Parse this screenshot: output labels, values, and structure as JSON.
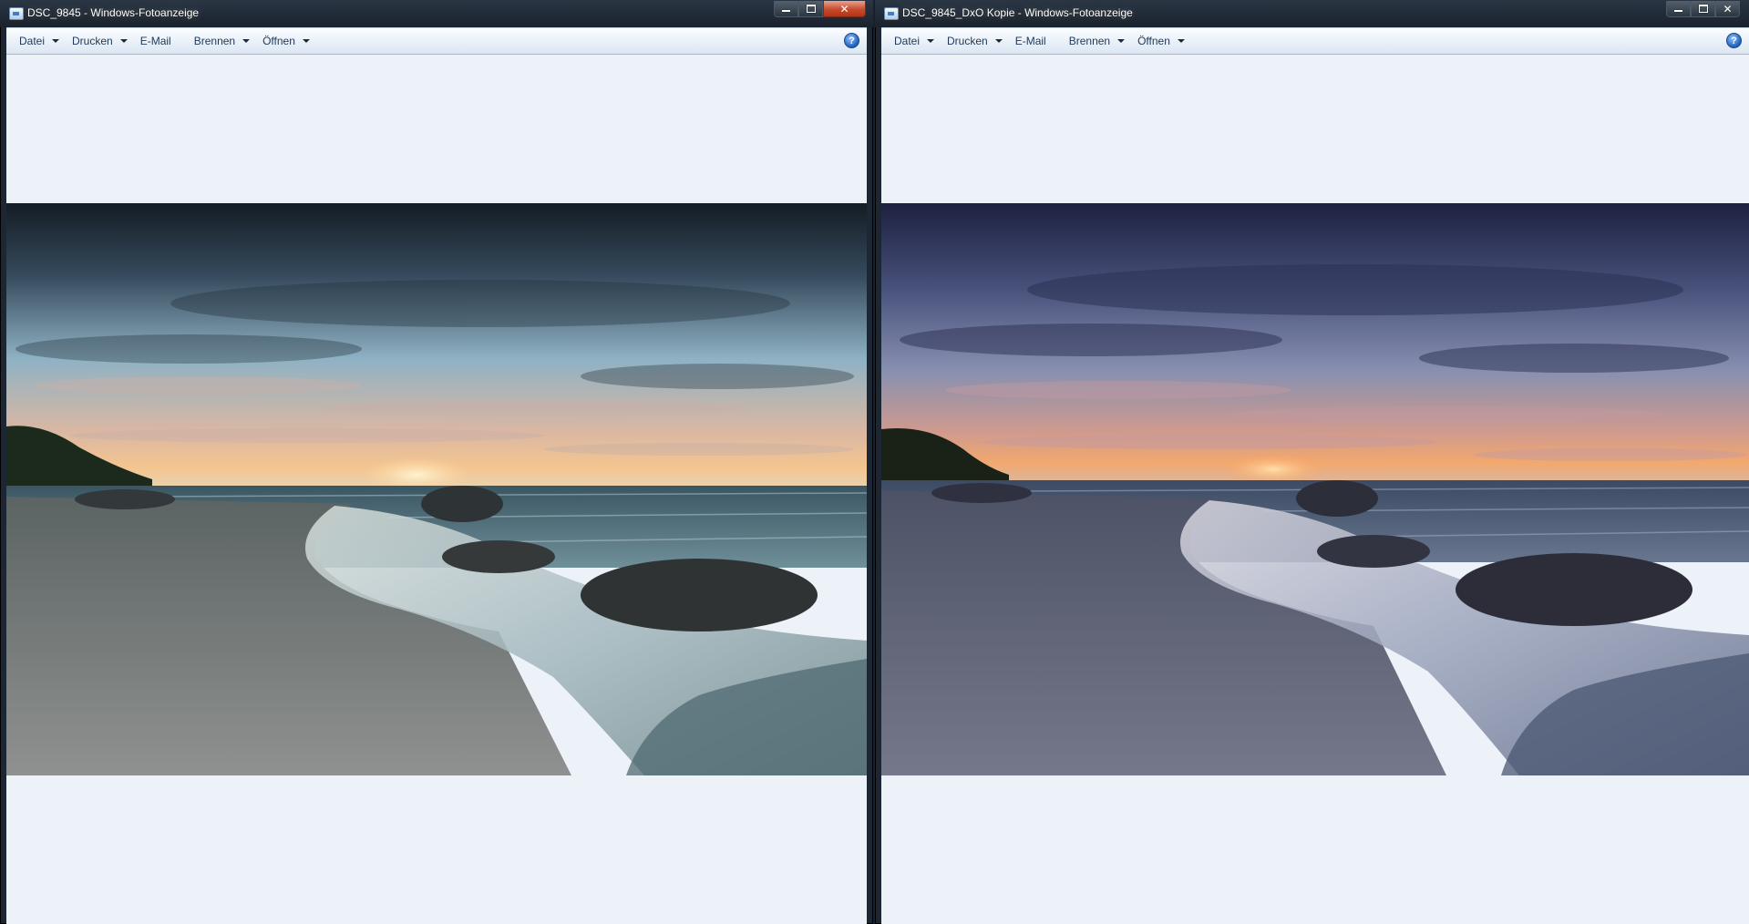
{
  "windows": [
    {
      "title": "DSC_9845 - Windows-Fotoanzeige",
      "menu": [
        {
          "label": "Datei",
          "dropdown": true
        },
        {
          "label": "Drucken",
          "dropdown": true
        },
        {
          "label": "E-Mail",
          "dropdown": false
        },
        {
          "label": "Brennen",
          "dropdown": true
        },
        {
          "label": "Öffnen",
          "dropdown": true
        }
      ],
      "help_glyph": "?",
      "photo_tone": "original-teal"
    },
    {
      "title": "DSC_9845_DxO Kopie - Windows-Fotoanzeige",
      "menu": [
        {
          "label": "Datei",
          "dropdown": true
        },
        {
          "label": "Drucken",
          "dropdown": true
        },
        {
          "label": "E-Mail",
          "dropdown": false
        },
        {
          "label": "Brennen",
          "dropdown": true
        },
        {
          "label": "Öffnen",
          "dropdown": true
        }
      ],
      "help_glyph": "?",
      "photo_tone": "dxo-blue"
    }
  ],
  "icons": [
    "photo-viewer-icon",
    "minimize-icon",
    "maximize-icon",
    "close-icon",
    "chevron-down-icon",
    "help-icon"
  ],
  "colors": {
    "chrome_dark": "#1a222c",
    "client_bg": "#edf2f9",
    "menu_text": "#1e395b",
    "close_red": "#c74a2d"
  }
}
